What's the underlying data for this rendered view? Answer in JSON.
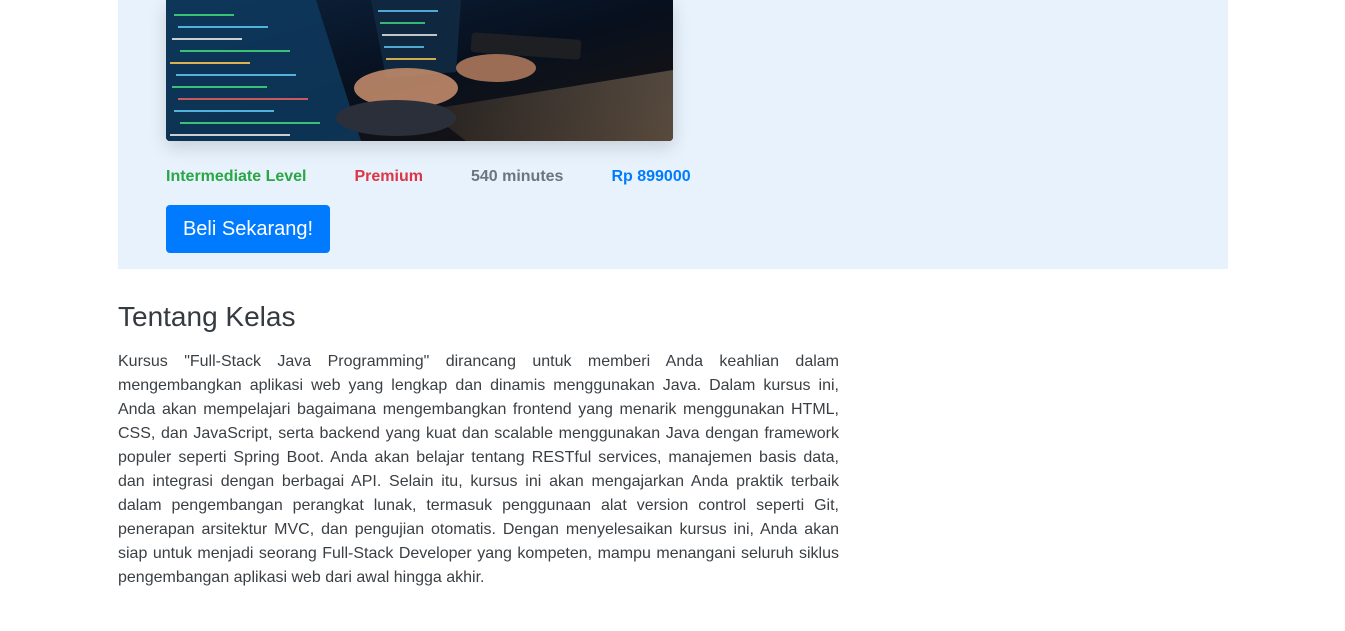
{
  "course": {
    "level": "Intermediate Level",
    "tier": "Premium",
    "duration": "540 minutes",
    "price": "Rp 899000",
    "buy_label": "Beli Sekarang!"
  },
  "about": {
    "title": "Tentang Kelas",
    "description": "Kursus \"Full-Stack Java Programming\" dirancang untuk memberi Anda keahlian dalam mengembangkan aplikasi web yang lengkap dan dinamis menggunakan Java. Dalam kursus ini, Anda akan mempelajari bagaimana mengembangkan frontend yang menarik menggunakan HTML, CSS, dan JavaScript, serta backend yang kuat dan scalable menggunakan Java dengan framework populer seperti Spring Boot. Anda akan belajar tentang RESTful services, manajemen basis data, dan integrasi dengan berbagai API. Selain itu, kursus ini akan mengajarkan Anda praktik terbaik dalam pengembangan perangkat lunak, termasuk penggunaan alat version control seperti Git, penerapan arsitektur MVC, dan pengujian otomatis. Dengan menyelesaikan kursus ini, Anda akan siap untuk menjadi seorang Full-Stack Developer yang kompeten, mampu menangani seluruh siklus pengembangan aplikasi web dari awal hingga akhir."
  },
  "colors": {
    "hero_background": "#e8f2fc",
    "level": "#28a745",
    "tier": "#dc3545",
    "duration": "#6c757d",
    "price": "#007bff",
    "button": "#007bff"
  }
}
